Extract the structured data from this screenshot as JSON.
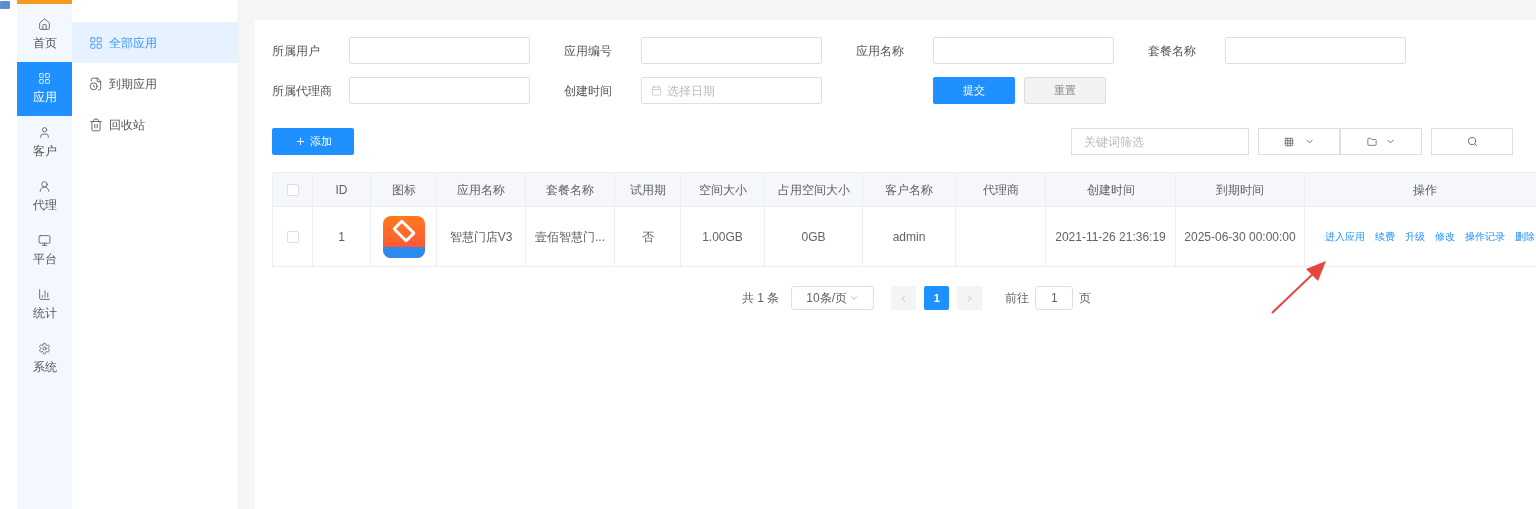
{
  "nav_rail": [
    {
      "label": "首页",
      "selected": false
    },
    {
      "label": "应用",
      "selected": true
    },
    {
      "label": "客户",
      "selected": false
    },
    {
      "label": "代理",
      "selected": false
    },
    {
      "label": "平台",
      "selected": false
    },
    {
      "label": "统计",
      "selected": false
    },
    {
      "label": "系统",
      "selected": false
    }
  ],
  "sub_menu": [
    {
      "label": "全部应用",
      "selected": true
    },
    {
      "label": "到期应用",
      "selected": false
    },
    {
      "label": "回收站",
      "selected": false
    }
  ],
  "filters": [
    {
      "label": "所属用户",
      "kind": "text"
    },
    {
      "label": "应用编号",
      "kind": "text"
    },
    {
      "label": "应用名称",
      "kind": "text"
    },
    {
      "label": "套餐名称",
      "kind": "text"
    },
    {
      "label": "所属代理商",
      "kind": "text"
    },
    {
      "label": "创建时间",
      "kind": "date",
      "placeholder": "选择日期"
    }
  ],
  "submit_button": "提交",
  "reset_button": "重置",
  "add_button": "添加",
  "toolbar": {
    "search": {
      "placeholder": "关键词筛选"
    }
  },
  "table": {
    "columns": [
      "ID",
      "图标",
      "应用名称",
      "套餐名称",
      "试用期",
      "空间大小",
      "占用空间大小",
      "客户名称",
      "代理商",
      "创建时间",
      "到期时间",
      "操作"
    ],
    "all_checked": false,
    "rows": [
      {
        "checked": false,
        "id": "1",
        "app_name": "智慧门店V3",
        "package": "壹佰智慧门...",
        "trial": "否",
        "space": "1.00GB",
        "used_space": "0GB",
        "customer": "admin",
        "agent": "",
        "created": "2021-11-26 21:36:19",
        "expires": "2025-06-30 00:00:00",
        "actions": [
          "进入应用",
          "续费",
          "升级",
          "修改",
          "操作记录",
          "删除"
        ]
      }
    ]
  },
  "pagination": {
    "total": "共 1 条",
    "page_size": "10条/页",
    "pages": [
      {
        "label": "1",
        "selected": true
      }
    ],
    "goto_label": "前往",
    "goto_value": "1",
    "goto_suffix": "页"
  }
}
